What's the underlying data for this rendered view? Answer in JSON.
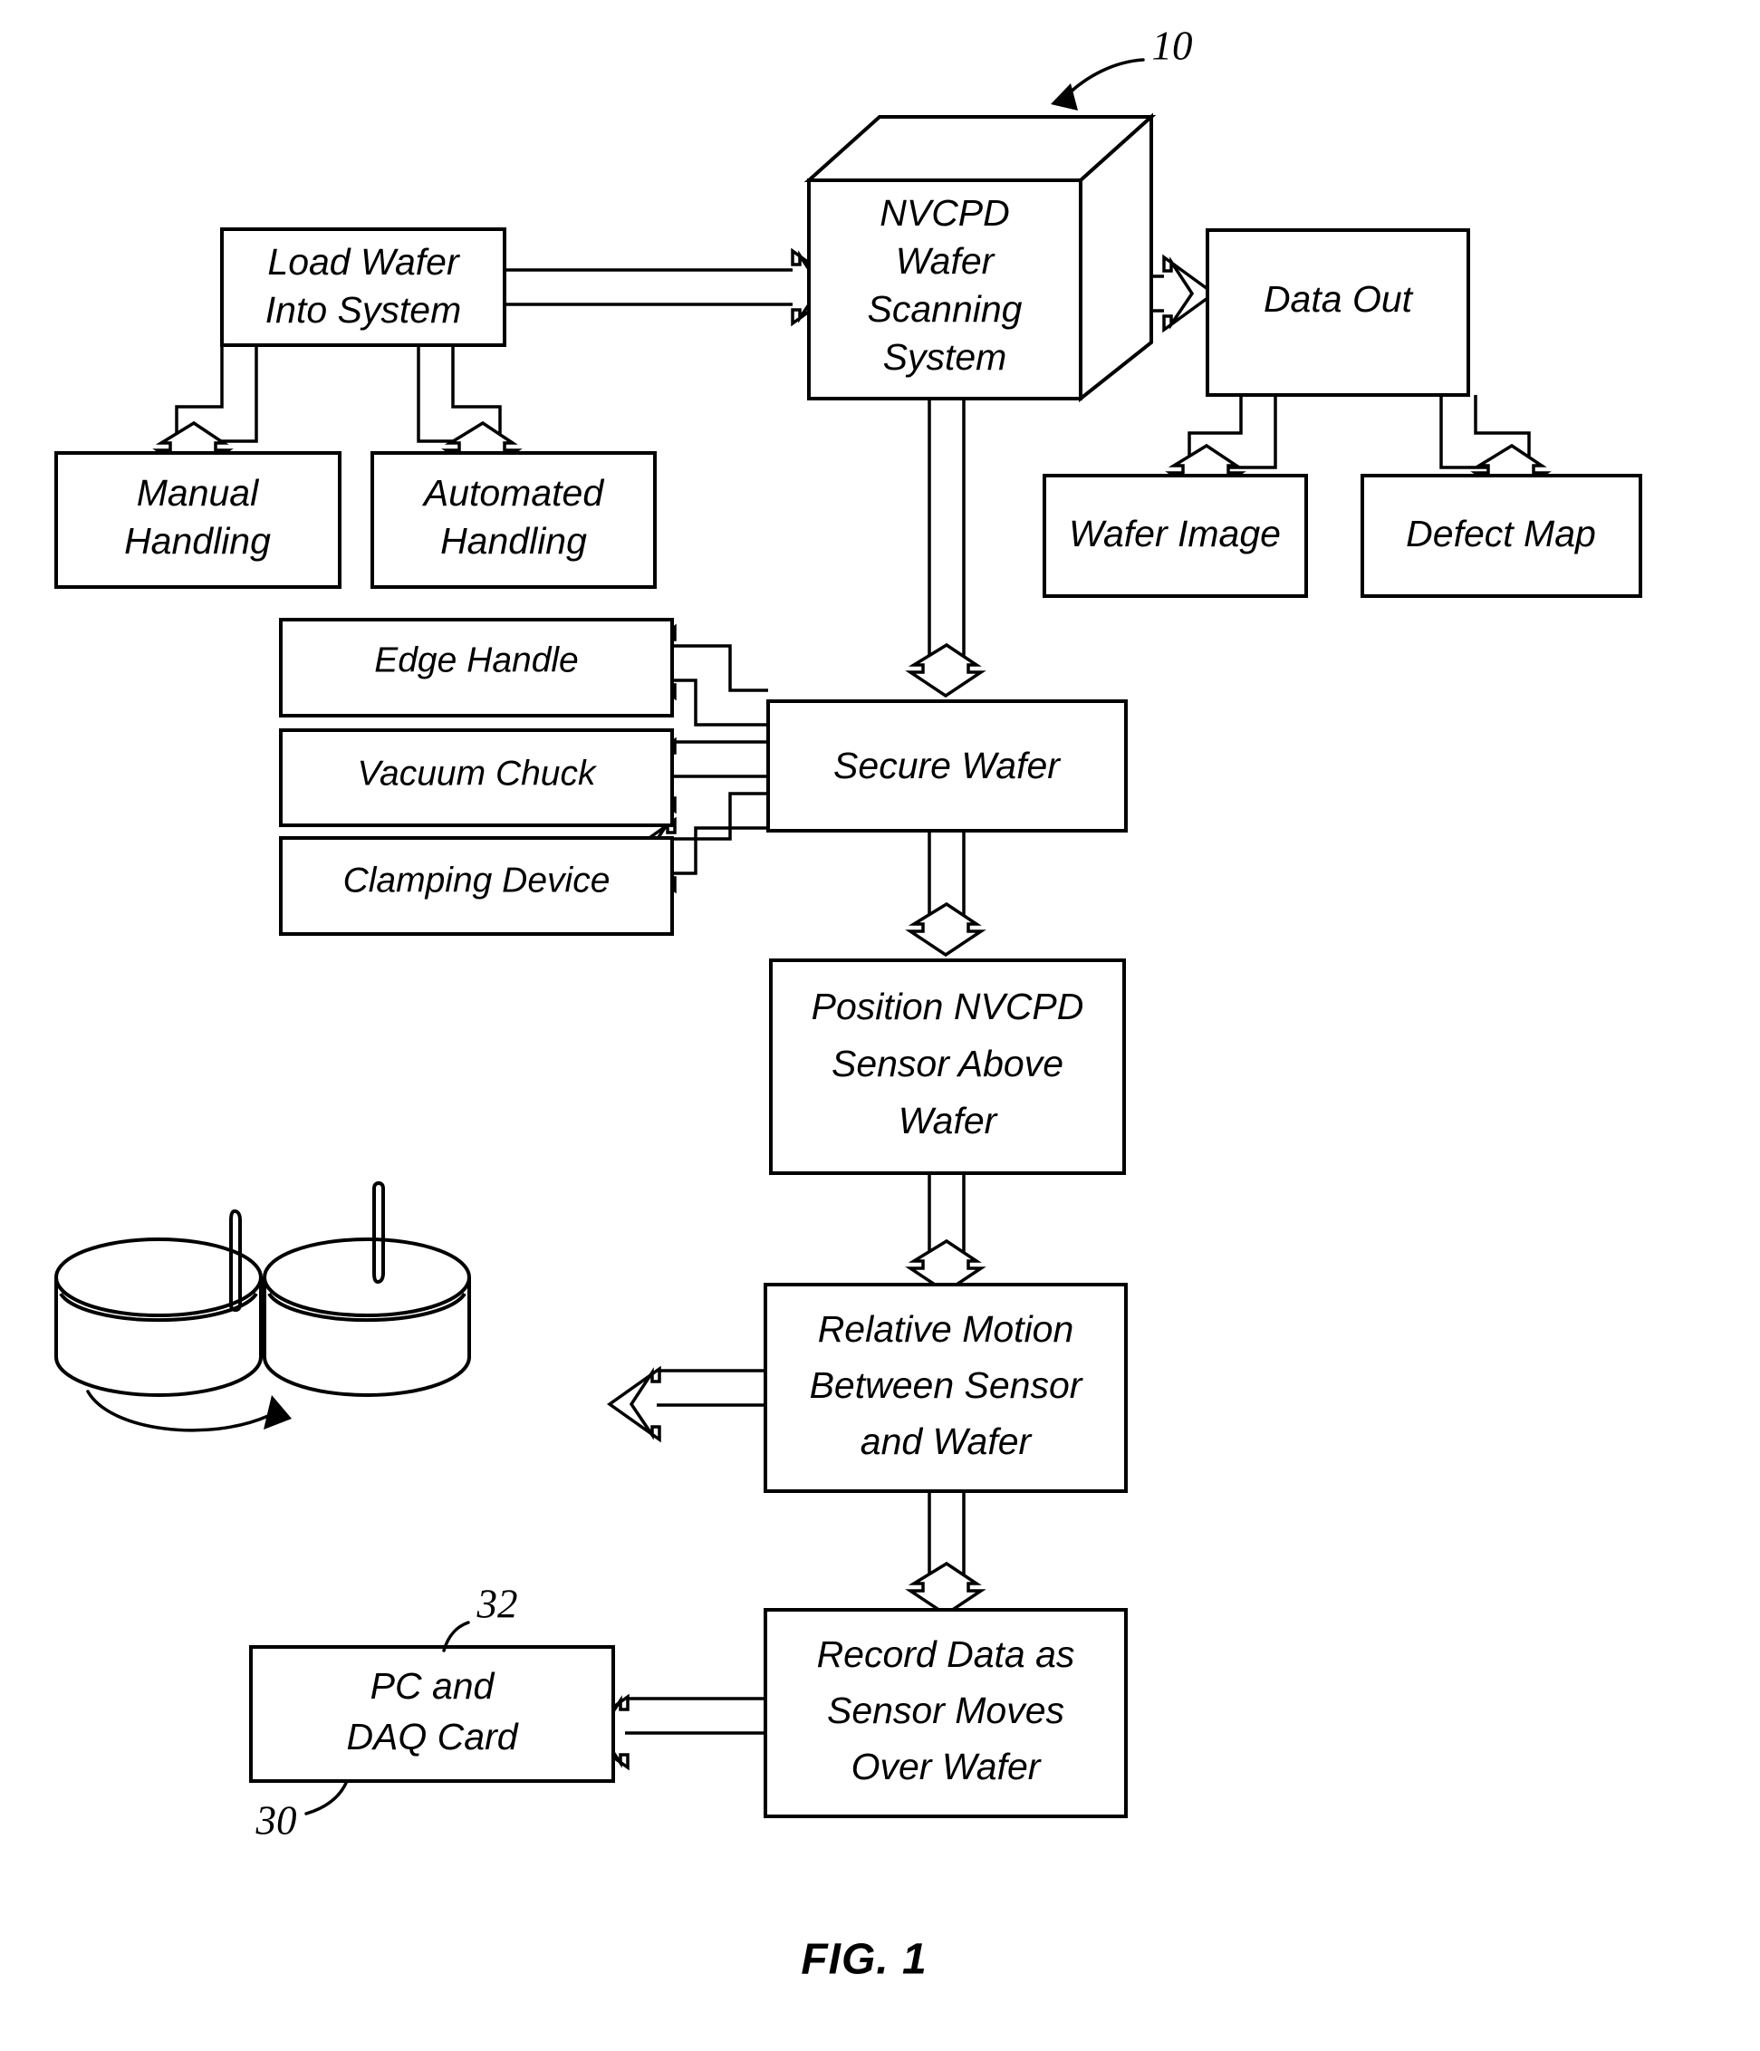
{
  "figure": {
    "caption": "FIG. 1",
    "reference_numbers": [
      {
        "id": "ref-10",
        "label": "10"
      },
      {
        "id": "ref-30",
        "label": "30"
      },
      {
        "id": "ref-32",
        "label": "32"
      }
    ]
  },
  "nodes": {
    "load_wafer": {
      "lines": [
        "Load Wafer",
        "Into System"
      ]
    },
    "nvcpd_system": {
      "lines": [
        "NVCPD",
        "Wafer",
        "Scanning",
        "System"
      ]
    },
    "data_out": {
      "lines": [
        "Data Out"
      ]
    },
    "manual_handling": {
      "lines": [
        "Manual",
        "Handling"
      ]
    },
    "automated_handling": {
      "lines": [
        "Automated",
        "Handling"
      ]
    },
    "wafer_image": {
      "lines": [
        "Wafer Image"
      ]
    },
    "defect_map": {
      "lines": [
        "Defect Map"
      ]
    },
    "edge_handle": {
      "lines": [
        "Edge Handle"
      ]
    },
    "vacuum_chuck": {
      "lines": [
        "Vacuum Chuck"
      ]
    },
    "clamping_device": {
      "lines": [
        "Clamping Device"
      ]
    },
    "secure_wafer": {
      "lines": [
        "Secure Wafer"
      ]
    },
    "position_sensor": {
      "lines": [
        "Position NVCPD",
        "Sensor Above",
        "Wafer"
      ]
    },
    "relative_motion": {
      "lines": [
        "Relative Motion",
        "Between Sensor",
        "and Wafer"
      ]
    },
    "record_data": {
      "lines": [
        "Record Data as",
        "Sensor Moves",
        "Over Wafer"
      ]
    },
    "pc_daq": {
      "lines": [
        "PC and",
        "DAQ Card"
      ]
    }
  },
  "chart_data": {
    "type": "diagram",
    "title": "FIG. 1",
    "subtype": "flowchart",
    "nodes": [
      {
        "id": "load_wafer",
        "label": "Load Wafer Into System",
        "shape": "rect"
      },
      {
        "id": "nvcpd_system",
        "label": "NVCPD Wafer Scanning System",
        "shape": "cube"
      },
      {
        "id": "data_out",
        "label": "Data Out",
        "shape": "rect"
      },
      {
        "id": "manual_handling",
        "label": "Manual Handling",
        "shape": "rect"
      },
      {
        "id": "automated_handling",
        "label": "Automated Handling",
        "shape": "rect"
      },
      {
        "id": "wafer_image",
        "label": "Wafer Image",
        "shape": "rect"
      },
      {
        "id": "defect_map",
        "label": "Defect Map",
        "shape": "rect"
      },
      {
        "id": "edge_handle",
        "label": "Edge Handle",
        "shape": "rect"
      },
      {
        "id": "vacuum_chuck",
        "label": "Vacuum Chuck",
        "shape": "rect"
      },
      {
        "id": "clamping_device",
        "label": "Clamping Device",
        "shape": "rect"
      },
      {
        "id": "secure_wafer",
        "label": "Secure Wafer",
        "shape": "rect"
      },
      {
        "id": "position_sensor",
        "label": "Position NVCPD Sensor Above Wafer",
        "shape": "rect"
      },
      {
        "id": "relative_motion",
        "label": "Relative Motion Between Sensor and Wafer",
        "shape": "rect"
      },
      {
        "id": "record_data",
        "label": "Record Data as Sensor Moves Over Wafer",
        "shape": "rect"
      },
      {
        "id": "pc_daq",
        "label": "PC and DAQ Card",
        "shape": "rect",
        "ref": "30"
      },
      {
        "id": "wafer_cylinders",
        "label": "rotating and translating wafer illustration",
        "shape": "cylinder-pair"
      }
    ],
    "edges": [
      {
        "from": "load_wafer",
        "to": "nvcpd_system"
      },
      {
        "from": "load_wafer",
        "to": "manual_handling"
      },
      {
        "from": "load_wafer",
        "to": "automated_handling"
      },
      {
        "from": "nvcpd_system",
        "to": "data_out"
      },
      {
        "from": "nvcpd_system",
        "to": "secure_wafer"
      },
      {
        "from": "data_out",
        "to": "wafer_image"
      },
      {
        "from": "data_out",
        "to": "defect_map"
      },
      {
        "from": "secure_wafer",
        "to": "edge_handle"
      },
      {
        "from": "secure_wafer",
        "to": "vacuum_chuck"
      },
      {
        "from": "secure_wafer",
        "to": "clamping_device"
      },
      {
        "from": "secure_wafer",
        "to": "position_sensor"
      },
      {
        "from": "position_sensor",
        "to": "relative_motion"
      },
      {
        "from": "relative_motion",
        "to": "wafer_cylinders"
      },
      {
        "from": "relative_motion",
        "to": "record_data"
      },
      {
        "from": "record_data",
        "to": "pc_daq"
      }
    ],
    "annotations": [
      {
        "label": "10",
        "points_to": "nvcpd_system"
      },
      {
        "label": "32",
        "points_to": "pc_daq"
      },
      {
        "label": "30",
        "points_to": "pc_daq"
      }
    ]
  }
}
